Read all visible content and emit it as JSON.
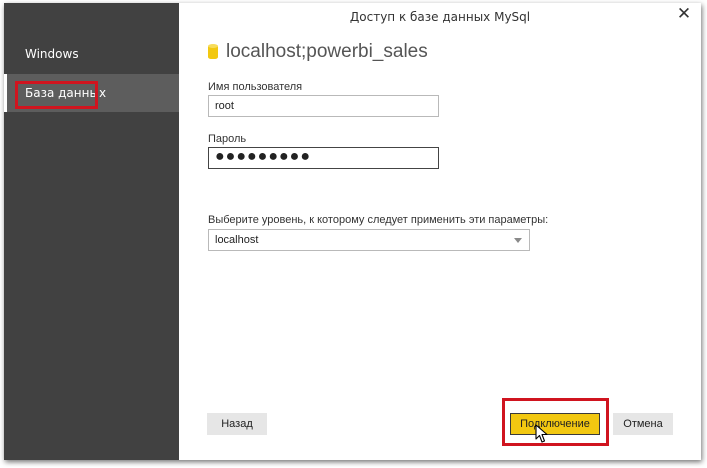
{
  "dialog": {
    "title": "Доступ к базе данных MySql",
    "close_glyph": "✕"
  },
  "sidebar": {
    "items": [
      {
        "label": "Windows",
        "selected": false
      },
      {
        "label": "База данных",
        "selected": true
      }
    ]
  },
  "datasource": {
    "name": "localhost;powerbi_sales",
    "icon": "database-icon"
  },
  "form": {
    "username_label": "Имя пользователя",
    "username_value": "root",
    "password_label": "Пароль",
    "password_value": "●●●●●●●●●",
    "level_label": "Выберите уровень, к которому следует применить эти параметры:",
    "level_value": "localhost"
  },
  "buttons": {
    "back": "Назад",
    "connect": "Подключение",
    "cancel": "Отмена"
  },
  "colors": {
    "sidebar_bg": "#414141",
    "selected_bg": "#5d5d5d",
    "accent_yellow": "#f2c811",
    "highlight_red": "#d0141f"
  }
}
